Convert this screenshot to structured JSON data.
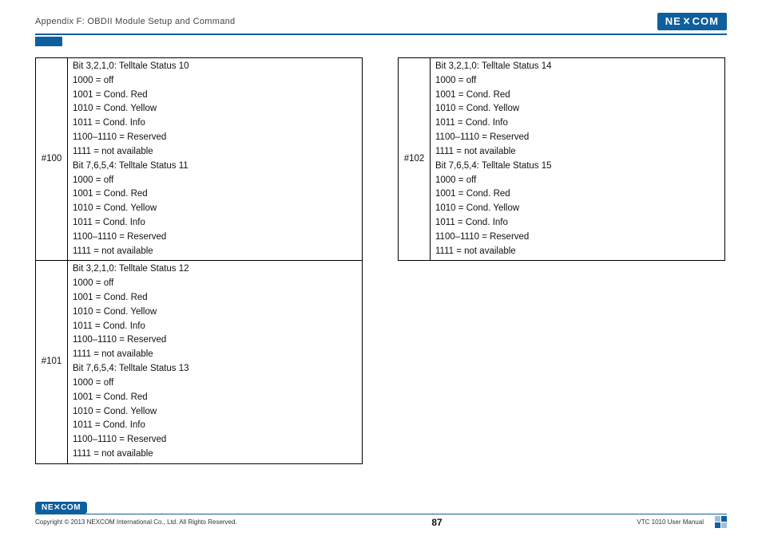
{
  "header": {
    "title": "Appendix F: OBDII Module Setup and Command",
    "logo_text": "NE COM",
    "logo_x": "X"
  },
  "footer": {
    "logo_text": "NE COM",
    "logo_x": "X",
    "copyright": "Copyright © 2013 NEXCOM International Co., Ltd. All Rights Reserved.",
    "page": "87",
    "manual": "VTC 1010 User Manual"
  },
  "left_rows": [
    {
      "idx": "#100",
      "lines": [
        "Bit 3,2,1,0: Telltale Status 10",
        "1000 = off",
        "1001 = Cond. Red",
        "1010 = Cond. Yellow",
        "1011 = Cond. Info",
        "1100–1110 = Reserved",
        "1111 = not available",
        "Bit 7,6,5,4: Telltale Status 11",
        "1000 = off",
        "1001 = Cond. Red",
        "1010 = Cond. Yellow",
        "1011 = Cond. Info",
        "1100–1110 = Reserved",
        "1111 = not available"
      ]
    },
    {
      "idx": "#101",
      "lines": [
        "Bit 3,2,1,0: Telltale Status 12",
        "1000 = off",
        "1001 = Cond. Red",
        "1010 = Cond. Yellow",
        "1011 = Cond. Info",
        "1100–1110 = Reserved",
        "1111 = not available",
        "Bit 7,6,5,4: Telltale Status 13",
        "1000 = off",
        "1001 = Cond. Red",
        "1010 = Cond. Yellow",
        "1011 = Cond. Info",
        "1100–1110 = Reserved",
        "1111 = not available"
      ]
    }
  ],
  "right_rows": [
    {
      "idx": "#102",
      "lines": [
        "Bit 3,2,1,0: Telltale Status 14",
        "1000 = off",
        "1001 = Cond. Red",
        "1010 = Cond. Yellow",
        "1011 = Cond. Info",
        "1100–1110 = Reserved",
        "1111 = not available",
        "Bit 7,6,5,4: Telltale Status 15",
        "1000 = off",
        "1001 = Cond. Red",
        "1010 = Cond. Yellow",
        "1011 = Cond. Info",
        "1100–1110 = Reserved",
        "1111 = not available"
      ]
    }
  ]
}
